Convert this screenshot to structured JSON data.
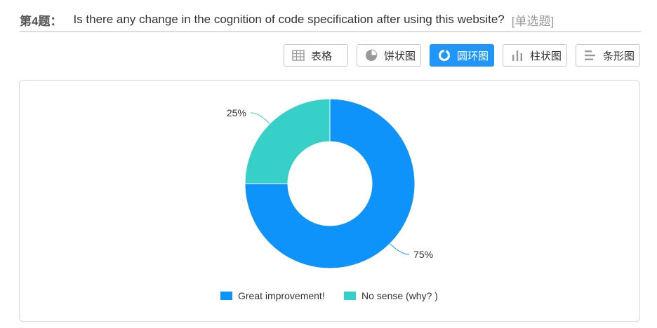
{
  "question": {
    "number": "第4题：",
    "text": "Is there any change in the cognition of code specification after using this website?",
    "type": "[单选题]"
  },
  "toolbar": {
    "buttons": [
      {
        "label": "表格",
        "icon": "table-icon",
        "active": false
      },
      {
        "label": "饼状图",
        "icon": "pie-chart-icon",
        "active": false
      },
      {
        "label": "圆环图",
        "icon": "donut-chart-icon",
        "active": true
      },
      {
        "label": "柱状图",
        "icon": "bar-chart-icon",
        "active": false
      },
      {
        "label": "条形图",
        "icon": "horizontal-bar-chart-icon",
        "active": false
      }
    ]
  },
  "chart_data": {
    "type": "pie",
    "variant": "donut",
    "categories": [
      "Great improvement!",
      "No sense (why? )"
    ],
    "values": [
      75,
      25
    ],
    "labels": [
      "75%",
      "25%"
    ],
    "colors": [
      "#0e93fa",
      "#36d0c9"
    ],
    "legend_position": "bottom"
  },
  "colors": {
    "accent": "#1e96fa",
    "border": "#d9d9d9"
  }
}
